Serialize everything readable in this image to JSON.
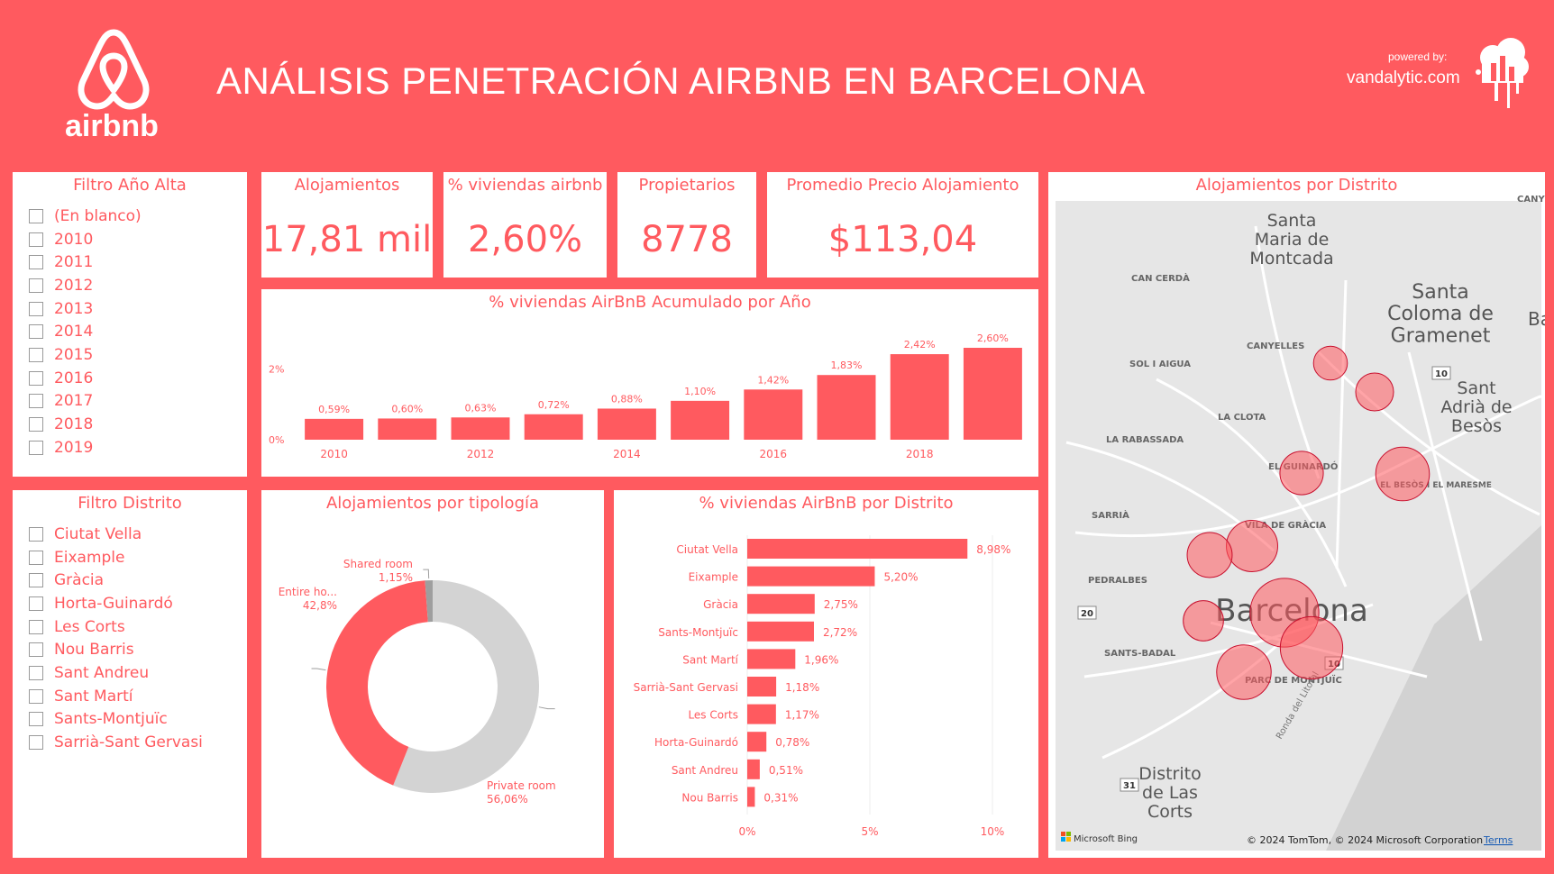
{
  "header": {
    "title": "ANÁLISIS PENETRACIÓN AIRBNB EN BARCELONA",
    "logo_text": "airbnb",
    "powered_by": "powered by:",
    "brand": "vandalytic.com"
  },
  "colors": {
    "accent": "#FF5A5F",
    "neutral": "#D3D3D3",
    "map_bg": "#E6E6E6"
  },
  "filter_year": {
    "title": "Filtro Año Alta",
    "items": [
      "(En blanco)",
      "2010",
      "2011",
      "2012",
      "2013",
      "2014",
      "2015",
      "2016",
      "2017",
      "2018",
      "2019"
    ]
  },
  "filter_district": {
    "title": "Filtro Distrito",
    "items": [
      "Ciutat Vella",
      "Eixample",
      "Gràcia",
      "Horta-Guinardó",
      "Les Corts",
      "Nou Barris",
      "Sant Andreu",
      "Sant Martí",
      "Sants-Montjuïc",
      "Sarrià-Sant Gervasi"
    ]
  },
  "kpis": {
    "alojamientos": {
      "label": "Alojamientos",
      "value": "17,81 mil"
    },
    "viviendas": {
      "label": "% viviendas airbnb",
      "value": "2,60%"
    },
    "propietarios": {
      "label": "Propietarios",
      "value": "8778"
    },
    "precio": {
      "label": "Promedio Precio Alojamiento",
      "value": "$113,04"
    }
  },
  "chart_data": [
    {
      "type": "bar",
      "title": "% viviendas AirBnB Acumulado por Año",
      "categories": [
        "2010",
        "2011",
        "2012",
        "2013",
        "2014",
        "2015",
        "2016",
        "2017",
        "2018",
        "2019"
      ],
      "values": [
        0.59,
        0.6,
        0.63,
        0.72,
        0.88,
        1.1,
        1.42,
        1.83,
        2.42,
        2.6
      ],
      "data_labels": [
        "0,59%",
        "0,60%",
        "0,63%",
        "0,72%",
        "0,88%",
        "1,10%",
        "1,42%",
        "1,83%",
        "2,42%",
        "2,60%"
      ],
      "x_tick_labels": [
        "2010",
        "",
        "2012",
        "",
        "2014",
        "",
        "2016",
        "",
        "2018",
        ""
      ],
      "y_ticks": [
        "0%",
        "2%"
      ],
      "ylim": [
        0,
        2.6
      ]
    },
    {
      "type": "pie",
      "title": "Alojamientos por tipología",
      "series": [
        {
          "name": "Private room",
          "value": 56.06,
          "label": "56,06%",
          "color": "#D3D3D3"
        },
        {
          "name": "Entire ho...",
          "value": 42.8,
          "label": "42,8%",
          "color": "#FF5A5F"
        },
        {
          "name": "Shared room",
          "value": 1.15,
          "label": "1,15%",
          "color": "#9E9E9E"
        }
      ]
    },
    {
      "type": "bar",
      "orientation": "horizontal",
      "title": "% viviendas AirBnB por Distrito",
      "categories": [
        "Ciutat Vella",
        "Eixample",
        "Gràcia",
        "Sants-Montjuïc",
        "Sant Martí",
        "Sarrià-Sant Gervasi",
        "Les Corts",
        "Horta-Guinardó",
        "Sant Andreu",
        "Nou Barris"
      ],
      "values": [
        8.98,
        5.2,
        2.75,
        2.72,
        1.96,
        1.18,
        1.17,
        0.78,
        0.51,
        0.31
      ],
      "data_labels": [
        "8,98%",
        "5,20%",
        "2,75%",
        "2,72%",
        "1,96%",
        "1,18%",
        "1,17%",
        "0,78%",
        "0,51%",
        "0,31%"
      ],
      "x_ticks": [
        "0%",
        "5%",
        "10%"
      ],
      "xlim": [
        0,
        10
      ]
    }
  ],
  "map": {
    "title": "Alojamientos por Distrito",
    "place_labels": [
      "Santa Maria de Montcada",
      "Santa Coloma de Gramenet",
      "Sant Adrià de Besòs",
      "Barcelona",
      "Distrito de Las Corts",
      "CAN CERDÀ",
      "CANYELLES",
      "SOL I AIGUA",
      "LA CLOTA",
      "LA RABASSADA",
      "EL GUINARDÓ",
      "EL BESÒS I EL MARESME",
      "SARRIÀ",
      "VILA DE GRÀCIA",
      "PEDRALBES",
      "SANTS-BADAL",
      "PARC DE MONTJUÏC",
      "CANYE",
      "Ba",
      "Ronda del Litoral"
    ],
    "road_shields": [
      "10",
      "20",
      "31",
      "10"
    ],
    "bing_label": "Microsoft Bing",
    "copyright": "© 2024 TomTom, © 2024 Microsoft Corporation",
    "terms": "Terms",
    "bubbles": [
      {
        "district": "Nou Barris",
        "relative_size": 0.2
      },
      {
        "district": "Sant Andreu",
        "relative_size": 0.25
      },
      {
        "district": "Horta-Guinardó",
        "relative_size": 0.32
      },
      {
        "district": "Sant Martí",
        "relative_size": 0.45
      },
      {
        "district": "Gràcia",
        "relative_size": 0.42
      },
      {
        "district": "Sarrià-Sant Gervasi",
        "relative_size": 0.34
      },
      {
        "district": "Les Corts",
        "relative_size": 0.28
      },
      {
        "district": "Eixample",
        "relative_size": 0.64
      },
      {
        "district": "Ciutat Vella",
        "relative_size": 0.56
      },
      {
        "district": "Sants-Montjuïc",
        "relative_size": 0.46
      }
    ]
  }
}
